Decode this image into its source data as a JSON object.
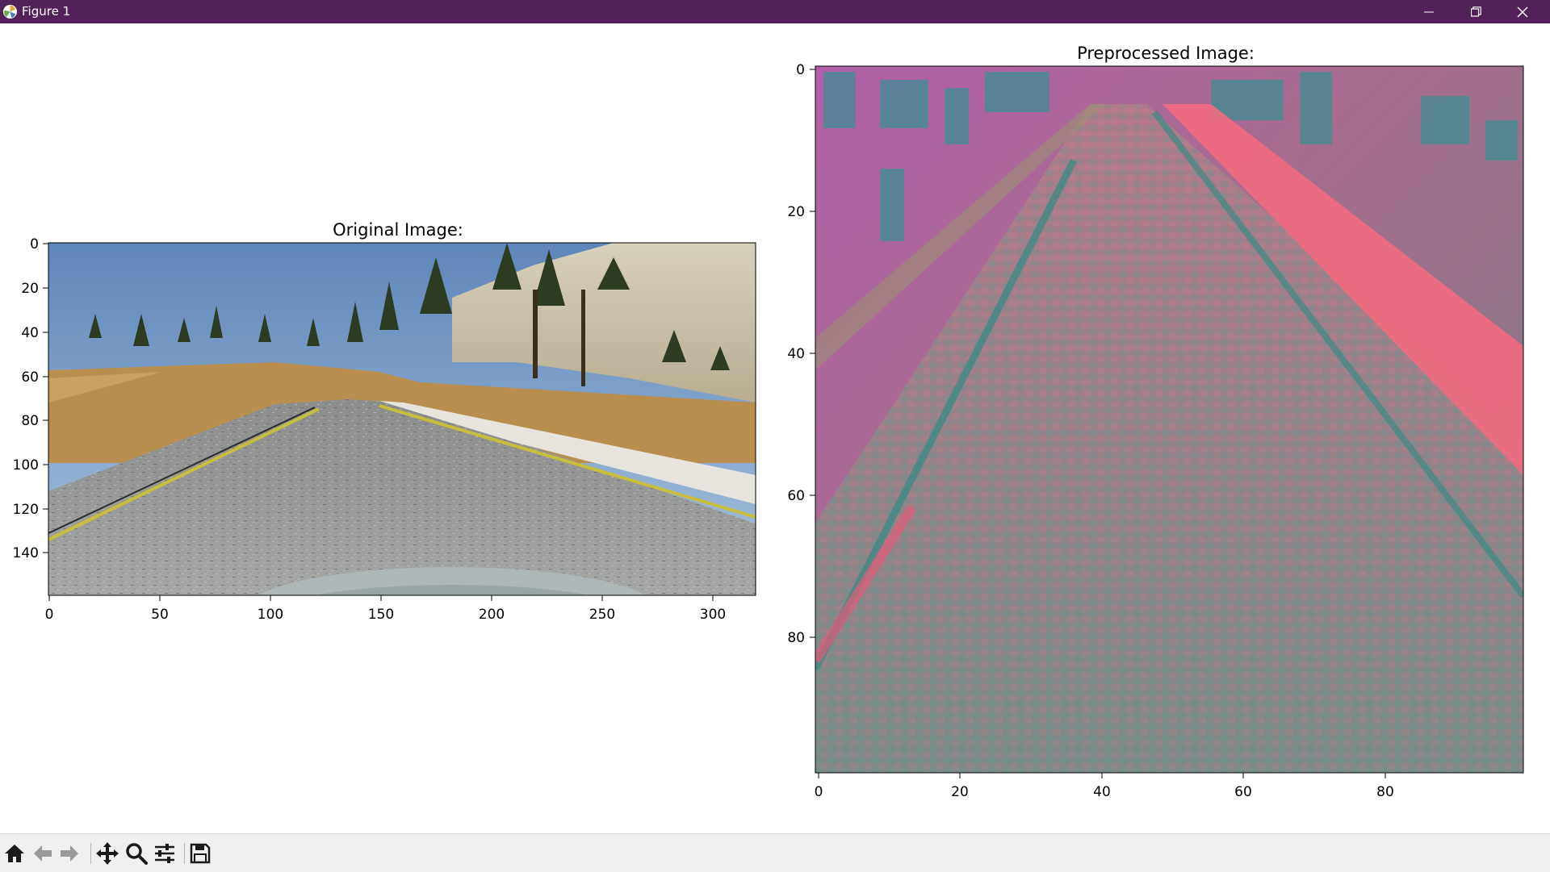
{
  "window": {
    "title": "Figure 1",
    "controls": [
      "minimize",
      "restore",
      "close"
    ],
    "titlebar_color": "#52215a"
  },
  "toolbar": {
    "buttons": [
      {
        "name": "home",
        "icon": "home-icon"
      },
      {
        "name": "back",
        "icon": "arrow-left-icon"
      },
      {
        "name": "forward",
        "icon": "arrow-right-icon"
      },
      {
        "name": "pan",
        "icon": "move-icon"
      },
      {
        "name": "zoom",
        "icon": "magnifier-icon"
      },
      {
        "name": "configure-subplots",
        "icon": "sliders-icon"
      },
      {
        "name": "save",
        "icon": "floppy-disk-icon"
      }
    ]
  },
  "figure": {
    "left_axes": {
      "title": "Original Image:",
      "image": "road scene from driving simulator: asphalt road with yellow lane lines, dirt shoulder, pine trees, rocky hillside, blue sky",
      "xticks": [
        "0",
        "50",
        "100",
        "150",
        "200",
        "250",
        "300"
      ],
      "yticks": [
        "0",
        "20",
        "40",
        "60",
        "80",
        "100",
        "120",
        "140"
      ],
      "xlim": [
        -0.5,
        319.5
      ],
      "ylim": [
        159.5,
        -0.5
      ]
    },
    "right_axes": {
      "title": "Preprocessed Image:",
      "image": "cropped, YUV-converted road image in pink, magenta and teal tones",
      "xticks": [
        "0",
        "20",
        "40",
        "60",
        "80"
      ],
      "yticks": [
        "0",
        "20",
        "40",
        "60",
        "80"
      ],
      "xlim": [
        -0.5,
        99.5
      ],
      "ylim": [
        99.5,
        -0.5
      ]
    }
  }
}
